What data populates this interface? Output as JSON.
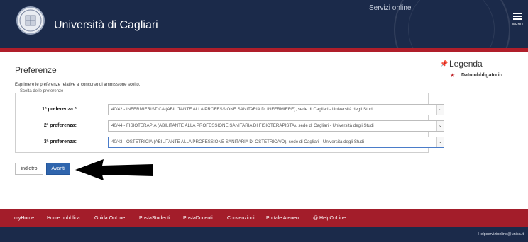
{
  "header": {
    "university_name": "Università di Cagliari",
    "services_label": "Servizi online",
    "menu_label": "MENU"
  },
  "page": {
    "title": "Preferenze",
    "intro": "Esprimere le preferenze relative al concorso di ammissione scelto.",
    "fieldset_legend": "Scelta delle preferenze",
    "rows": [
      {
        "label": "1ª preferenza:*",
        "value": "40/42 - INFERMIERISTICA (ABILITANTE ALLA PROFESSIONE SANITARIA DI INFERMIERE), sede di Cagliari - Università degli Studi"
      },
      {
        "label": "2ª preferenza:",
        "value": "40/44 - FISIOTERAPIA (ABILITANTE ALLA PROFESSIONE SANITARIA DI FISIOTERAPISTA), sede di Cagliari - Università degli Studi"
      },
      {
        "label": "3ª preferenza:",
        "value": "40/43 - OSTETRICIA (ABILITANTE ALLA PROFESSIONE SANITARIA DI OSTETRICA/O), sede di Cagliari - Università degli Studi"
      }
    ],
    "back_button": "indietro",
    "next_button": "Avanti"
  },
  "legend": {
    "title": "Legenda",
    "required_item": "Dato obbligatorio"
  },
  "footer": {
    "links": [
      "myHome",
      "Home pubblica",
      "Guida OnLine",
      "PostaStudenti",
      "PostaDocenti",
      "Convenzioni",
      "Portale Ateneo",
      "@ HelpOnLine"
    ],
    "help_email": "Helpservizionline@unica.it"
  },
  "colors": {
    "header_bg": "#1b2a4a",
    "accent_red": "#b01e2a",
    "primary_button": "#2f65ad"
  }
}
